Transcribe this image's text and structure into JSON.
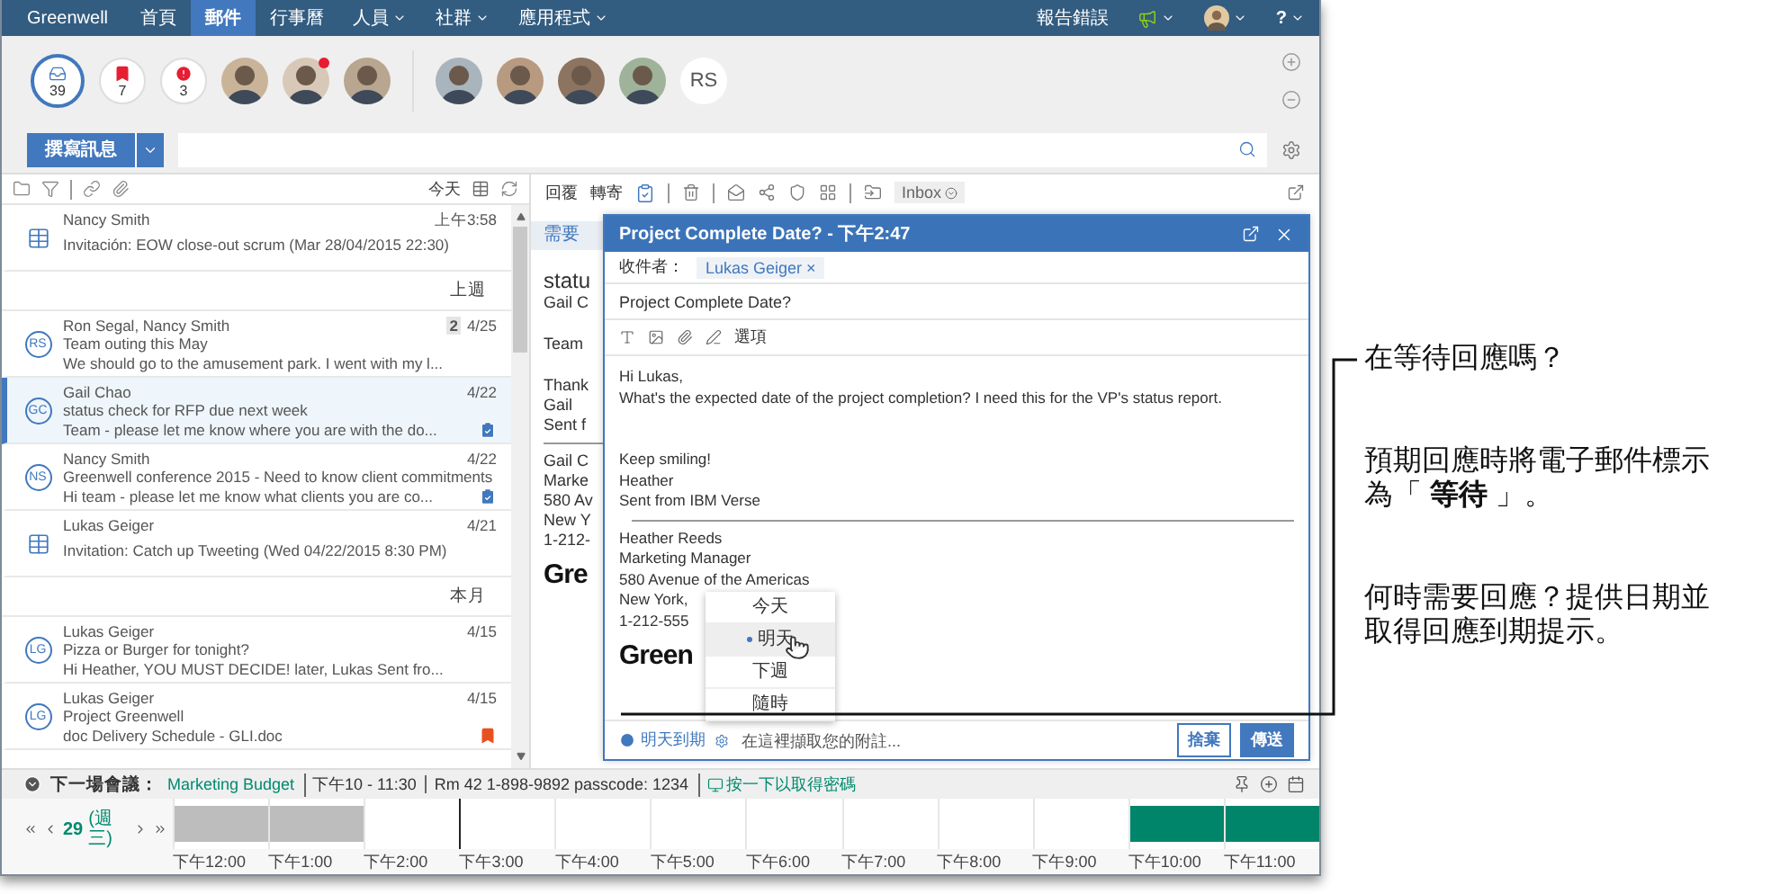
{
  "nav": {
    "brand": "Greenwell",
    "tabs": [
      {
        "label": "首頁",
        "selected": false,
        "menu": false
      },
      {
        "label": "郵件",
        "selected": true,
        "menu": false
      },
      {
        "label": "行事曆",
        "selected": false,
        "menu": false
      },
      {
        "label": "人員",
        "selected": false,
        "menu": true
      },
      {
        "label": "社群",
        "selected": false,
        "menu": true
      },
      {
        "label": "應用程式",
        "selected": false,
        "menu": true
      }
    ],
    "report_link": "報告錯誤",
    "help": "?"
  },
  "contacts_bar": {
    "counters": [
      {
        "kind": "inbox",
        "count": "39",
        "selected": true
      },
      {
        "kind": "flag",
        "count": "7",
        "selected": false
      },
      {
        "kind": "alert",
        "count": "3",
        "selected": false
      }
    ],
    "favorites": [
      {
        "kind": "photo",
        "notified": false
      },
      {
        "kind": "photo",
        "notified": true
      },
      {
        "kind": "photo",
        "notified": false
      }
    ],
    "recent": [
      {
        "kind": "photo"
      },
      {
        "kind": "photo"
      },
      {
        "kind": "photo"
      },
      {
        "kind": "photo"
      },
      {
        "kind": "initials",
        "initials": "RS"
      }
    ]
  },
  "compose_button": "撰寫訊息",
  "mail_list": {
    "today_label": "今天",
    "items": [
      {
        "kind": "mail",
        "avatar": {
          "kind": "calendar"
        },
        "sender": "Nancy Smith",
        "subject": "Invitación: EOW close-out scrum (Mar 28/04/2015 22:30)",
        "date": "上午3:58",
        "selected": false
      },
      {
        "kind": "header",
        "label": "上週"
      },
      {
        "kind": "mail",
        "avatar": {
          "kind": "initials",
          "initials": "RS"
        },
        "sender": "Ron Segal, Nancy Smith",
        "subject": "Team outing this May",
        "preview": "We should go to the amusement park. I went with my l...",
        "count": "2",
        "date": "4/25",
        "selected": false
      },
      {
        "kind": "mail",
        "avatar": {
          "kind": "initials",
          "initials": "GC"
        },
        "sender": "Gail Chao",
        "subject": "status check for RFP due next week",
        "preview": "Team - please let me know where you are with the do...",
        "date": "4/22",
        "flag": {
          "kind": "waiting"
        },
        "selected": true
      },
      {
        "kind": "mail",
        "avatar": {
          "kind": "initials",
          "initials": "NS"
        },
        "sender": "Nancy Smith",
        "subject": "Greenwell conference 2015 - Need to know client commitments",
        "preview": "Hi team - please let me know what clients you are co...",
        "date": "4/22",
        "flag": {
          "kind": "waiting"
        },
        "selected": false
      },
      {
        "kind": "mail",
        "avatar": {
          "kind": "calendar"
        },
        "sender": "Lukas Geiger",
        "subject": "Invitation: Catch up Tweeting (Wed 04/22/2015 8:30 PM)",
        "date": "4/21",
        "selected": false
      },
      {
        "kind": "header",
        "label": "本月"
      },
      {
        "kind": "mail",
        "avatar": {
          "kind": "initials",
          "initials": "LG"
        },
        "sender": "Lukas Geiger",
        "subject": "Pizza or Burger for tonight?",
        "preview": "Hi Heather, YOU MUST DECIDE! later, Lukas Sent fro...",
        "date": "4/15",
        "selected": false
      },
      {
        "kind": "mail",
        "avatar": {
          "kind": "initials",
          "initials": "LG"
        },
        "sender": "Lukas Geiger",
        "subject": "Project Greenwell",
        "preview": "doc Delivery Schedule - GLI.doc",
        "date": "4/15",
        "flag": {
          "kind": "urgent"
        },
        "selected": false
      }
    ]
  },
  "reader": {
    "reply": "回覆",
    "forward": "轉寄",
    "folder": "Inbox",
    "action": "需要",
    "title": "statu",
    "from": "Gail C",
    "paragraphs": [
      [
        "Team"
      ],
      [
        "Thank",
        "Gail",
        "Sent f"
      ]
    ],
    "signature": [
      "Gail C",
      "Marke",
      "580 Av",
      "New Y",
      "1-212-"
    ],
    "logo": "Gre"
  },
  "compose": {
    "title": "Project Complete Date? - 下午2:47",
    "to_label": "收件者：",
    "recipients": [
      {
        "name": "Lukas Geiger",
        "remove": "×"
      }
    ],
    "subject": "Project Complete Date?",
    "options": "選項",
    "paragraphs": [
      [
        "Hi Lukas,",
        "What's the expected date of the project completion? I need this for the VP's status report."
      ],
      [
        "Keep smiling!",
        "Heather",
        "Sent from IBM Verse"
      ]
    ],
    "signature": [
      "Heather Reeds",
      "Marketing Manager",
      "580 Avenue of the Americas",
      "New York,",
      "1-212-555"
    ],
    "logo": "Green",
    "due_menu": [
      {
        "label": "今天",
        "selected": false
      },
      {
        "label": "明天",
        "selected": true
      },
      {
        "label": "下週",
        "selected": false
      },
      {
        "label": "隨時",
        "selected": false
      }
    ],
    "due_link": "明天到期",
    "note_placeholder": "在這裡擷取您的附註...",
    "discard": "捨棄",
    "send": "傳送"
  },
  "meeting": {
    "label": "下一場會議：",
    "title": "Marketing Budget",
    "time": "下午10 - 11:30",
    "room": "Rm 42 1-898-9892 passcode: 1234",
    "passcode_link": "按一下以取得密碼"
  },
  "timeline": {
    "day": "29",
    "weekday": "(週三)",
    "slots": [
      {
        "label": "下午12:00",
        "kind": "busy",
        "current": false
      },
      {
        "label": "下午1:00",
        "kind": "busy",
        "current": false
      },
      {
        "label": "下午2:00",
        "kind": "free",
        "current": false
      },
      {
        "label": "下午3:00",
        "kind": "free",
        "current": true
      },
      {
        "label": "下午4:00",
        "kind": "free",
        "current": false
      },
      {
        "label": "下午5:00",
        "kind": "free",
        "current": false
      },
      {
        "label": "下午6:00",
        "kind": "free",
        "current": false
      },
      {
        "label": "下午7:00",
        "kind": "free",
        "current": false
      },
      {
        "label": "下午8:00",
        "kind": "free",
        "current": false
      },
      {
        "label": "下午9:00",
        "kind": "free",
        "current": false
      },
      {
        "label": "下午10:00",
        "kind": "meeting",
        "current": false
      },
      {
        "label": "下午11:00",
        "kind": "meeting",
        "current": false
      }
    ]
  },
  "annotations": [
    {
      "text": "在等待回應嗎？"
    },
    {
      "text": "預期回應時將電子郵件標示為「 **等待** 」。"
    },
    {
      "text": "何時需要回應？提供日期並取得回應到期提示。"
    }
  ]
}
